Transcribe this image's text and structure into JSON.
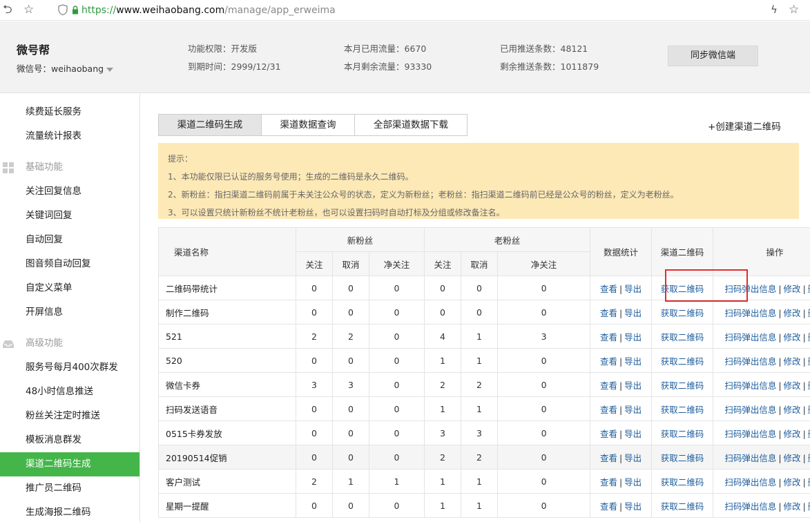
{
  "browser": {
    "url_scheme": "https://",
    "url_host": "www.weihaobang.com",
    "url_path": "/manage/app_erweima",
    "back_icon": "undo-icon",
    "star_icon": "star-icon"
  },
  "header": {
    "brand": "微号帮",
    "wechat_id": "微信号：weihaobang",
    "stats": [
      "功能权限：开发版",
      "到期时间：2999/12/31",
      "本月已用流量：6670",
      "本月剩余流量：93330",
      "已用推送条数：48121",
      "剩余推送条数：1011879"
    ],
    "sync_button": "同步微信端"
  },
  "sidebar": {
    "top_items": [
      "续费延长服务",
      "流量统计报表"
    ],
    "basic_section": "基础功能",
    "basic_items": [
      "关注回复信息",
      "关键词回复",
      "自动回复",
      "图音频自动回复",
      "自定义菜单",
      "开屏信息"
    ],
    "advanced_section": "高级功能",
    "advanced_items": [
      "服务号每月400次群发",
      "48小时信息推送",
      "粉丝关注定时推送",
      "模板消息群发",
      "渠道二维码生成",
      "推广员二维码",
      "生成海报二维码"
    ],
    "active": "渠道二维码生成"
  },
  "tabs": [
    "渠道二维码生成",
    "渠道数据查询",
    "全部渠道数据下载"
  ],
  "create_link": "+创建渠道二维码",
  "tip": {
    "title": "提示：",
    "lines": [
      "1、本功能仅限已认证的服务号使用；生成的二维码是永久二维码。",
      "2、新粉丝：指扫渠道二维码前属于未关注公众号的状态，定义为新粉丝；老粉丝：指扫渠道二维码前已经是公众号的粉丝，定义为老粉丝。",
      "3、可以设置只统计新粉丝不统计老粉丝，也可以设置扫码时自动打标及分组或修改备注名。"
    ]
  },
  "table": {
    "headers": {
      "name": "渠道名称",
      "new_fans": "新粉丝",
      "old_fans": "老粉丝",
      "stats": "数据统计",
      "qrcode": "渠道二维码",
      "ops": "操作",
      "follow": "关注",
      "cancel": "取消",
      "net": "净关注"
    },
    "actions": {
      "view": "查看",
      "export": "导出",
      "get_qr": "获取二维码",
      "popup": "扫码弹出信息",
      "edit": "修改",
      "delete": "删除",
      "sep": "|"
    },
    "rows": [
      {
        "name": "二维码带统计",
        "n": [
          "0",
          "0",
          "0"
        ],
        "o": [
          "0",
          "0",
          "0"
        ]
      },
      {
        "name": "制作二维码",
        "n": [
          "0",
          "0",
          "0"
        ],
        "o": [
          "0",
          "0",
          "0"
        ]
      },
      {
        "name": "521",
        "n": [
          "2",
          "2",
          "0"
        ],
        "o": [
          "4",
          "1",
          "3"
        ]
      },
      {
        "name": "520",
        "n": [
          "0",
          "0",
          "0"
        ],
        "o": [
          "1",
          "1",
          "0"
        ]
      },
      {
        "name": "微信卡券",
        "n": [
          "3",
          "3",
          "0"
        ],
        "o": [
          "2",
          "2",
          "0"
        ]
      },
      {
        "name": "扫码发送语音",
        "n": [
          "0",
          "0",
          "0"
        ],
        "o": [
          "1",
          "1",
          "0"
        ]
      },
      {
        "name": "0515卡券发放",
        "n": [
          "0",
          "0",
          "0"
        ],
        "o": [
          "3",
          "3",
          "0"
        ]
      },
      {
        "name": "20190514促销",
        "n": [
          "0",
          "0",
          "0"
        ],
        "o": [
          "2",
          "2",
          "0"
        ]
      },
      {
        "name": "客户测试",
        "n": [
          "2",
          "1",
          "1"
        ],
        "o": [
          "1",
          "1",
          "0"
        ]
      },
      {
        "name": "星期一提醒",
        "n": [
          "0",
          "0",
          "0"
        ],
        "o": [
          "1",
          "1",
          "0"
        ]
      }
    ]
  },
  "colors": {
    "active_green": "#44b549",
    "link_blue": "#1e5d9c",
    "tip_bg": "#fde9b6",
    "highlight_red": "#e02d2d"
  }
}
